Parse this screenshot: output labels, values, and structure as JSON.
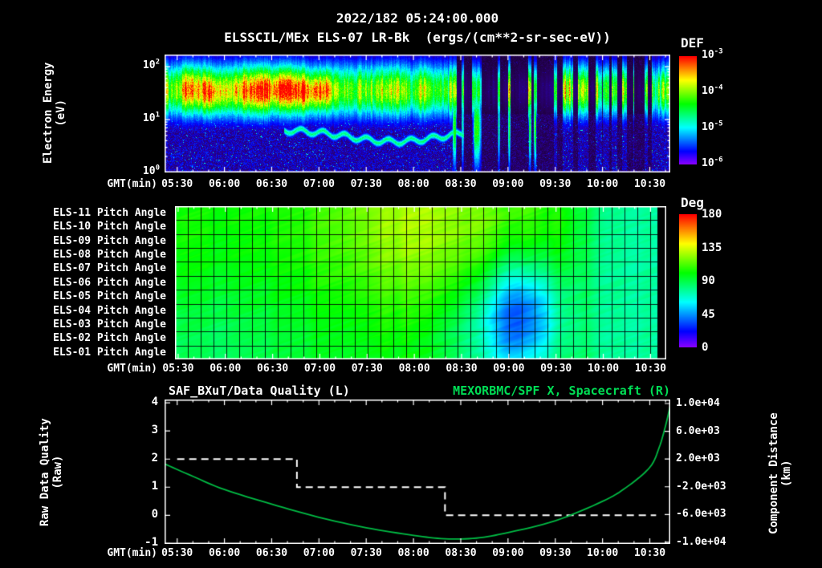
{
  "header": {
    "title": "2022/182 05:24:00.000",
    "subtitle": "ELSSCIL/MEx ELS-07 LR-Bk  (ergs/(cm**2-sr-sec-eV))"
  },
  "colors": {
    "background": "#000000",
    "axis_text": "#ffffff",
    "title_green": "#00dd55",
    "curve_green": "#00bb44"
  },
  "time_axis": {
    "label": "GMT(min)",
    "tick_labels": [
      "05:30",
      "06:00",
      "06:30",
      "07:00",
      "07:30",
      "08:00",
      "08:30",
      "09:00",
      "09:30",
      "10:00",
      "10:30"
    ],
    "tick_minutes": [
      330,
      360,
      390,
      420,
      450,
      480,
      510,
      540,
      570,
      600,
      630
    ]
  },
  "spectrogram_panel": {
    "ylabel": "Electron Energy",
    "ylabel_units": "(eV)",
    "yticks": [
      {
        "base": "10",
        "exp": "2"
      },
      {
        "base": "10",
        "exp": "1"
      },
      {
        "base": "10",
        "exp": "0"
      }
    ],
    "colorbar_title": "DEF",
    "colorbar_ticks": [
      {
        "base": "10",
        "exp": "-3"
      },
      {
        "base": "10",
        "exp": "-4"
      },
      {
        "base": "10",
        "exp": "-5"
      },
      {
        "base": "10",
        "exp": "-6"
      }
    ]
  },
  "pitch_panel": {
    "row_labels": [
      "ELS-11 Pitch Angle",
      "ELS-10 Pitch Angle",
      "ELS-09 Pitch Angle",
      "ELS-08 Pitch Angle",
      "ELS-07 Pitch Angle",
      "ELS-06 Pitch Angle",
      "ELS-05 Pitch Angle",
      "ELS-04 Pitch Angle",
      "ELS-03 Pitch Angle",
      "ELS-02 Pitch Angle",
      "ELS-01 Pitch Angle"
    ],
    "colorbar_title": "Deg",
    "colorbar_ticks": [
      "180",
      "135",
      "90",
      "45",
      "0"
    ]
  },
  "line_panel": {
    "title_left": "SAF_BXuT/Data Quality (L)",
    "title_right": "MEXORBMC/SPF X, Spacecraft (R)",
    "ylabel_left": "Raw Data Quality",
    "ylabel_left_units": "(Raw)",
    "left_ticks": [
      "4",
      "3",
      "2",
      "1",
      "0",
      "-1"
    ],
    "ylabel_right": "Component Distance",
    "ylabel_right_units": "(km)",
    "right_ticks": [
      "1.0e+04",
      "6.0e+03",
      "2.0e+03",
      "-2.0e+03",
      "-6.0e+03",
      "-1.0e+04"
    ]
  },
  "chart_data": [
    {
      "type": "heatmap",
      "panel": "electron_energy_spectrogram",
      "title": "ELSSCIL/MEx ELS-07 LR-Bk",
      "units": "ergs/(cm**2-sr-sec-eV)",
      "x_axis": {
        "label": "GMT(min)",
        "start": "05:22",
        "end": "10:43",
        "ticks": [
          "05:30",
          "06:00",
          "06:30",
          "07:00",
          "07:30",
          "08:00",
          "08:30",
          "09:00",
          "09:30",
          "10:00",
          "10:30"
        ]
      },
      "y_axis": {
        "label": "Electron Energy (eV)",
        "scale": "log",
        "min": 1,
        "max": 170,
        "ticks": [
          1,
          10,
          100
        ]
      },
      "color_axis": {
        "label": "DEF",
        "scale": "log",
        "min": 1e-06,
        "max": 0.001,
        "ticks": [
          0.001,
          0.0001,
          1e-05,
          1e-06
        ]
      },
      "visual_features": [
        "continuous bright green-yellow band between ~15 and ~100 eV from 05:22 until ~08:20 with vertical striations",
        "red-orange intensity maxima near 05:45 and 06:10-07:05 around 30-70 eV",
        "faint cyan trace dipping from ~8 eV at 06:45 to ~4 eV near 07:50, returning by 08:25",
        "after 08:20 the band breaks into intermittent vertical bursts separated by dark gaps",
        "narrow bursts 08:30-09:05 extend down to a few eV",
        "broader bright bands resume 09:45-10:35 and at the right edge",
        "dark blue/purple speckle background below ~10 eV and above ~110 eV"
      ]
    },
    {
      "type": "heatmap",
      "panel": "pitch_angle",
      "rows": [
        "ELS-11",
        "ELS-10",
        "ELS-09",
        "ELS-08",
        "ELS-07",
        "ELS-06",
        "ELS-05",
        "ELS-04",
        "ELS-03",
        "ELS-02",
        "ELS-01"
      ],
      "x_axis": {
        "label": "GMT(min)",
        "start": "05:28",
        "end": "10:40",
        "ticks": [
          "05:30",
          "06:00",
          "06:30",
          "07:00",
          "07:30",
          "08:00",
          "08:30",
          "09:00",
          "09:30",
          "10:00",
          "10:30"
        ]
      },
      "color_axis": {
        "label": "Deg",
        "min": 0,
        "max": 180,
        "ticks": [
          180,
          135,
          90,
          45,
          0
        ]
      },
      "visual_features": [
        "field mostly ~90-110 deg (green)",
        "upper anodes reach ~125 deg (yellow-green) between ~07:00 and 08:40",
        "blue region ~45-60 deg in lower anodes around 09:00-09:30",
        "cyan ~75 deg across all anodes after ~10:00",
        "black no-data column at far right edge",
        "black grid lines divide the panel into time-anode cells"
      ]
    },
    {
      "type": "line",
      "panel": "quality_and_spacecraft",
      "title_left": "SAF_BXuT/Data Quality (L)",
      "title_right": "MEXORBMC/SPF X, Spacecraft (R)",
      "x_axis": {
        "label": "GMT(min)",
        "start": "05:22",
        "end": "10:43"
      },
      "left_axis": {
        "label": "Raw Data Quality (Raw)",
        "min": -1,
        "max": 4,
        "ticks": [
          4,
          3,
          2,
          1,
          0,
          -1
        ]
      },
      "right_axis": {
        "label": "Component Distance (km)",
        "min": -10000,
        "max": 10000,
        "ticks": [
          10000,
          6000,
          2000,
          -2000,
          -6000,
          -10000
        ]
      },
      "series": [
        {
          "name": "SAF_BXuT/Data Quality",
          "axis": "left",
          "color": "#ffffff",
          "style": "dashed",
          "points": [
            [
              "05:30",
              2
            ],
            [
              "06:46",
              2
            ],
            [
              "06:46",
              1
            ],
            [
              "08:20",
              1
            ],
            [
              "08:20",
              0
            ],
            [
              "10:34",
              0
            ]
          ]
        },
        {
          "name": "MEXORBMC/SPF X Spacecraft",
          "axis": "right",
          "color": "#00bb44",
          "style": "solid",
          "units": "km",
          "points": [
            [
              "05:22",
              1300
            ],
            [
              "05:40",
              -500
            ],
            [
              "06:00",
              -2400
            ],
            [
              "06:30",
              -4500
            ],
            [
              "07:00",
              -6400
            ],
            [
              "07:30",
              -7900
            ],
            [
              "08:00",
              -9000
            ],
            [
              "08:20",
              -9500
            ],
            [
              "08:40",
              -9400
            ],
            [
              "09:00",
              -8600
            ],
            [
              "09:30",
              -6900
            ],
            [
              "10:00",
              -4100
            ],
            [
              "10:15",
              -2100
            ],
            [
              "10:30",
              800
            ],
            [
              "10:36",
              3700
            ],
            [
              "10:40",
              6800
            ],
            [
              "10:43",
              9700
            ]
          ]
        }
      ]
    }
  ]
}
